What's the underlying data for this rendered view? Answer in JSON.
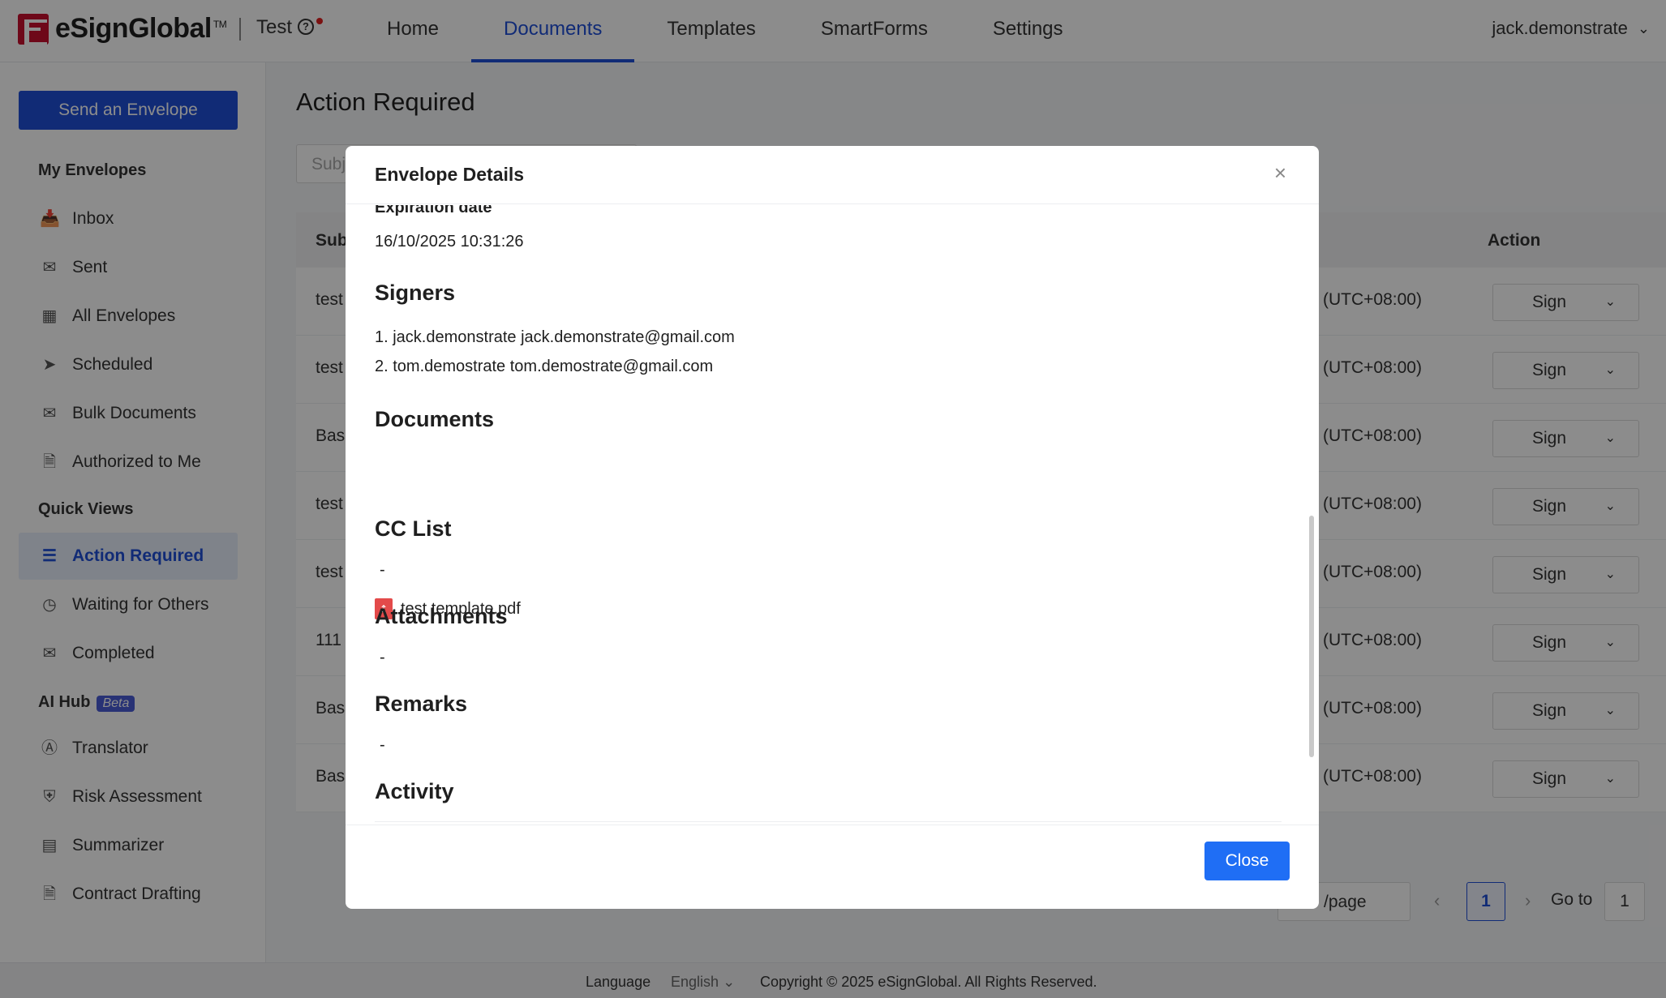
{
  "header": {
    "logo_text": "eSignGlobal",
    "logo_tm": "TM",
    "org_name": "Test",
    "org_help": "?",
    "nav": [
      "Home",
      "Documents",
      "Templates",
      "SmartForms",
      "Settings"
    ],
    "active_nav": "Documents",
    "user": "jack.demonstrate"
  },
  "sidebar": {
    "send_button": "Send an Envelope",
    "sections": {
      "my_envelopes": "My Envelopes",
      "quick_views": "Quick Views",
      "ai_hub": "AI Hub",
      "ai_hub_badge": "Beta"
    },
    "my_envelopes": [
      {
        "label": "Inbox",
        "icon": "inbox-icon"
      },
      {
        "label": "Sent",
        "icon": "sent-icon"
      },
      {
        "label": "All Envelopes",
        "icon": "grid-icon"
      },
      {
        "label": "Scheduled",
        "icon": "scheduled-icon"
      },
      {
        "label": "Bulk Documents",
        "icon": "bulk-icon"
      },
      {
        "label": "Authorized to Me",
        "icon": "authorized-icon"
      }
    ],
    "quick_views": [
      {
        "label": "Action Required",
        "icon": "action-required-icon"
      },
      {
        "label": "Waiting for Others",
        "icon": "clock-icon"
      },
      {
        "label": "Completed",
        "icon": "completed-icon"
      }
    ],
    "ai_hub": [
      {
        "label": "Translator",
        "icon": "translator-icon"
      },
      {
        "label": "Risk Assessment",
        "icon": "risk-icon"
      },
      {
        "label": "Summarizer",
        "icon": "summarizer-icon"
      },
      {
        "label": "Contract Drafting",
        "icon": "drafting-icon"
      }
    ],
    "active_item": "Action Required"
  },
  "main": {
    "title": "Action Required",
    "search_placeholder": "Subj",
    "columns": {
      "subject": "Sub",
      "action": "Action"
    },
    "rows": [
      {
        "subject": "test",
        "tz": "(UTC+08:00)",
        "action": "Sign"
      },
      {
        "subject": "test",
        "tz": "(UTC+08:00)",
        "action": "Sign"
      },
      {
        "subject": "Bas",
        "tz": "(UTC+08:00)",
        "action": "Sign"
      },
      {
        "subject": "test",
        "tz": "(UTC+08:00)",
        "action": "Sign"
      },
      {
        "subject": "test",
        "tz": "(UTC+08:00)",
        "action": "Sign"
      },
      {
        "subject": "111",
        "tz": "(UTC+08:00)",
        "action": "Sign"
      },
      {
        "subject": "Bas",
        "tz": "(UTC+08:00)",
        "action": "Sign"
      },
      {
        "subject": "Bas",
        "tz": "(UTC+08:00)",
        "action": "Sign"
      }
    ],
    "pagination": {
      "page_size": "/page",
      "current_page": "1",
      "goto_label": "Go to",
      "goto_value": "1"
    }
  },
  "footer": {
    "language_label": "Language",
    "language_value": "English",
    "copyright": "Copyright © 2025 eSignGlobal. All Rights Reserved."
  },
  "modal": {
    "title": "Envelope Details",
    "expiration_label": "Expiration date",
    "expiration_value": "16/10/2025 10:31:26",
    "signers_heading": "Signers",
    "signers": [
      "1. jack.demonstrate jack.demonstrate@gmail.com",
      "2. tom.demostrate tom.demostrate@gmail.com"
    ],
    "documents_heading": "Documents",
    "documents": [
      "test template.pdf"
    ],
    "cc_heading": "CC List",
    "cc_value": "-",
    "attachments_heading": "Attachments",
    "attachments_value": "-",
    "remarks_heading": "Remarks",
    "remarks_value": "-",
    "activity_heading": "Activity",
    "close_button": "Close"
  }
}
